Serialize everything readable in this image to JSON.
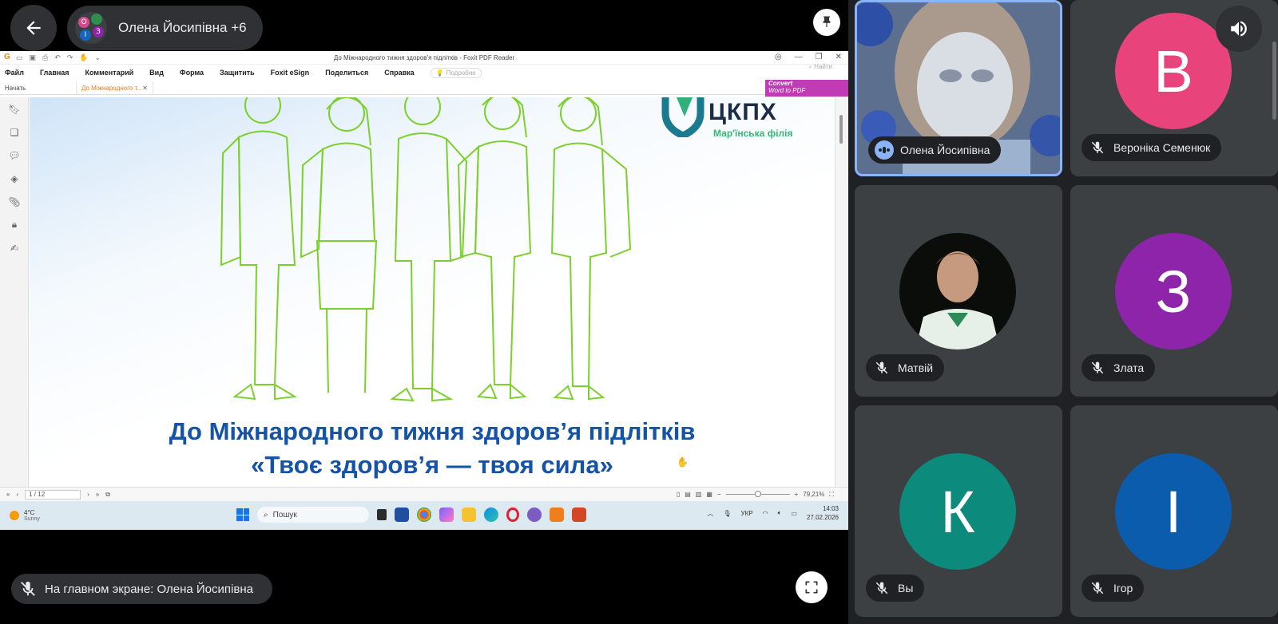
{
  "header": {
    "participants_title": "Олена Йосипівна +6",
    "mini_avatars": [
      {
        "letter": "О",
        "color": "#d64a8e"
      },
      {
        "letter": "",
        "color": "#2f8f4e"
      },
      {
        "letter": "І",
        "color": "#1565c0"
      },
      {
        "letter": "З",
        "color": "#8e24aa"
      }
    ]
  },
  "pdf": {
    "window_title": "До Міжнародного тижня здоров'я підлітків - Foxit PDF Reader",
    "menu": [
      "Файл",
      "Главная",
      "Комментарий",
      "Вид",
      "Форма",
      "Защитить",
      "Foxit eSign",
      "Поделиться",
      "Справка"
    ],
    "hint_label": "Подробне",
    "find_placeholder": "Найти",
    "convert_line1": "Convert",
    "convert_line2": "Word to PDF",
    "tabs": [
      {
        "label": "Начать"
      },
      {
        "label": "До Міжнародного т..."
      }
    ],
    "logo_text": "ЦКПХ",
    "logo_subtitle": "Мар'їнська філія",
    "slide_title_line1": "До Міжнародного тижня здоров’я підлітків",
    "slide_title_line2": "«Твоє здоров’я — твоя сила»",
    "page_indicator": "1 / 12",
    "zoom": "79,21%"
  },
  "taskbar": {
    "weather_temp": "4°C",
    "weather_desc": "Sunny",
    "search_placeholder": "Пошук",
    "language": "УКР",
    "time": "14:03",
    "date": "27.02.2026"
  },
  "presenting_label": "На главном экране: Олена Йосипівна",
  "participants": [
    {
      "name": "Олена Йосипівна",
      "type": "video",
      "speaking": true
    },
    {
      "name": "Вероніка Семенюк",
      "type": "letter",
      "letter": "В",
      "color": "#e8437a",
      "muted": true
    },
    {
      "name": "Матвій",
      "type": "photo",
      "muted": true
    },
    {
      "name": "Злата",
      "type": "letter",
      "letter": "З",
      "color": "#8e24aa",
      "muted": true
    },
    {
      "name": "Вы",
      "type": "letter",
      "letter": "К",
      "color": "#0c8a7c",
      "muted": true
    },
    {
      "name": "Ігор",
      "type": "letter",
      "letter": "І",
      "color": "#0b5cad",
      "muted": true
    }
  ],
  "colors": {
    "meet_bg": "#202124",
    "tile_bg": "#3c4043",
    "chip_bg": "#303134",
    "slide_title": "#1553a6",
    "illustration_line": "#7ccf2c",
    "active_speaker_border": "#8ab4f8"
  }
}
